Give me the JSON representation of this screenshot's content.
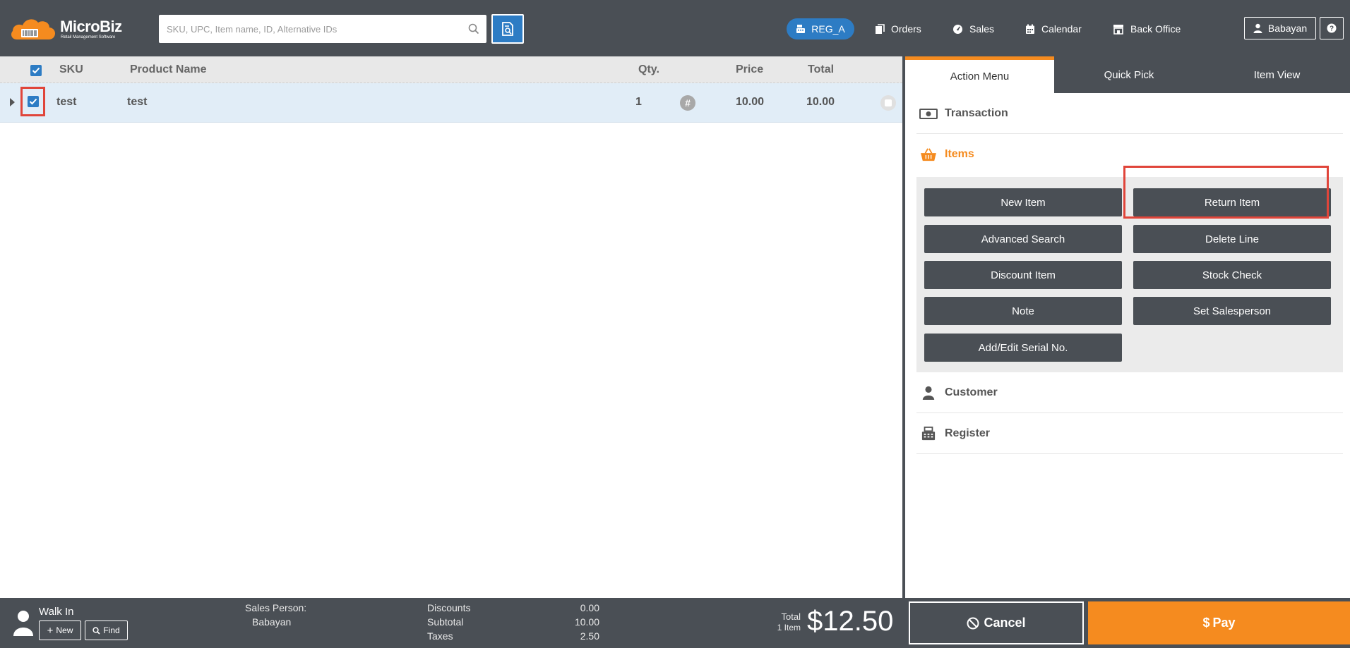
{
  "app": {
    "brand_name": "MicroBiz",
    "brand_tagline": "Retail Management Software"
  },
  "header": {
    "search_placeholder": "SKU, UPC, Item name, ID, Alternative IDs",
    "register_label": "REG_A",
    "nav": {
      "orders": "Orders",
      "sales": "Sales",
      "calendar": "Calendar",
      "back_office": "Back Office"
    },
    "user_label": "Babayan",
    "help_icon": "question-icon"
  },
  "grid": {
    "columns": {
      "sku": "SKU",
      "product_name": "Product Name",
      "qty": "Qty.",
      "price": "Price",
      "total": "Total"
    },
    "rows": [
      {
        "sku": "test",
        "product_name": "test",
        "qty": "1",
        "price": "10.00",
        "total": "10.00",
        "checked": true
      }
    ]
  },
  "panel": {
    "tabs": {
      "action_menu": "Action Menu",
      "quick_pick": "Quick Pick",
      "item_view": "Item View"
    },
    "sections": {
      "transaction": "Transaction",
      "items": "Items",
      "customer": "Customer",
      "register": "Register"
    },
    "item_actions": {
      "new_item": "New Item",
      "return_item": "Return Item",
      "advanced_search": "Advanced Search",
      "delete_line": "Delete Line",
      "discount_item": "Discount Item",
      "stock_check": "Stock Check",
      "note": "Note",
      "set_salesperson": "Set Salesperson",
      "add_edit_serial": "Add/Edit Serial No."
    }
  },
  "footer": {
    "customer_name": "Walk In",
    "new_label": "New",
    "find_label": "Find",
    "sales_person_label": "Sales Person:",
    "sales_person_value": "Babayan",
    "discounts_label": "Discounts",
    "discounts_value": "0.00",
    "subtotal_label": "Subtotal",
    "subtotal_value": "10.00",
    "taxes_label": "Taxes",
    "taxes_value": "2.50",
    "total_label": "Total",
    "item_count": "1 Item",
    "total_amount": "$12.50",
    "cancel_label": "Cancel",
    "pay_label": "Pay"
  },
  "colors": {
    "topbar": "#4a4f55",
    "accent_orange": "#f58b1f",
    "accent_blue": "#2d7cc4",
    "highlight_red": "#e0453a",
    "row_selected": "#e1edf7"
  }
}
